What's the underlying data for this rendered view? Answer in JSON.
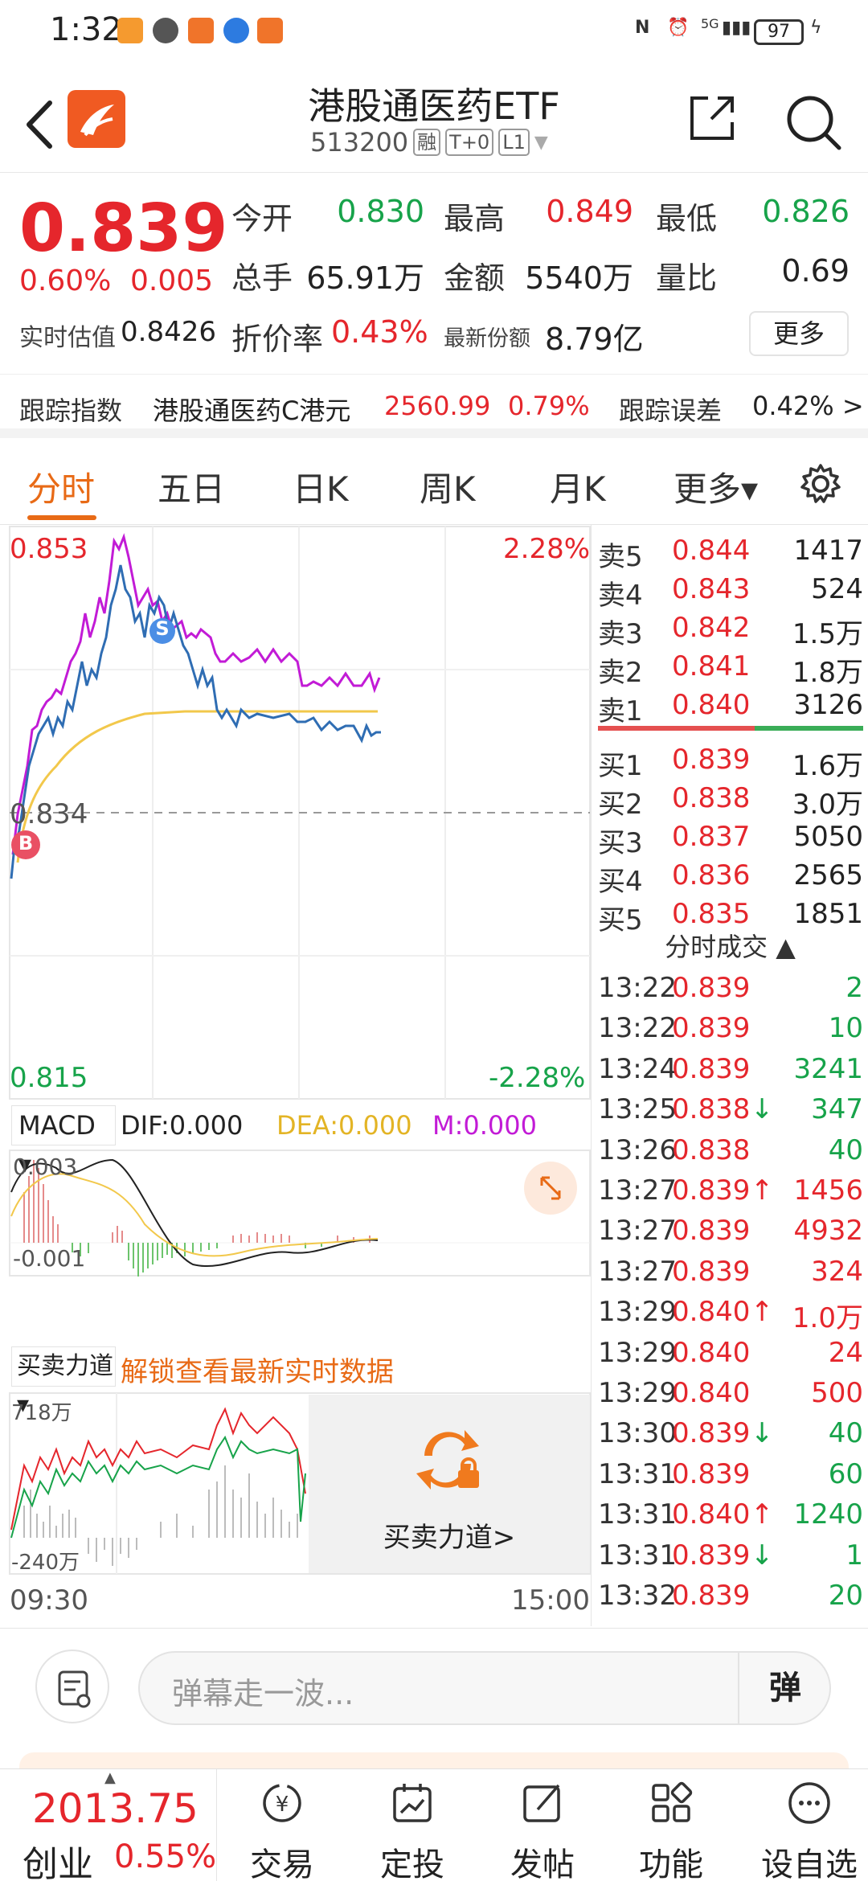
{
  "status_bar": {
    "time": "1:32",
    "signal": "5G",
    "battery": "97"
  },
  "header": {
    "title": "港股通医药ETF",
    "code": "513200",
    "tags": [
      "融",
      "T+0",
      "L1"
    ]
  },
  "quote": {
    "price": "0.839",
    "change_pct": "0.60%",
    "change": "0.005",
    "open_label": "今开",
    "open": "0.830",
    "high_label": "最高",
    "high": "0.849",
    "low_label": "最低",
    "low": "0.826",
    "volume_label": "总手",
    "volume": "65.91万",
    "amount_label": "金额",
    "amount": "5540万",
    "ratio_label": "量比",
    "ratio": "0.69",
    "iopv_label": "实时估值",
    "iopv": "0.8426",
    "premium_label": "折价率",
    "premium": "0.43%",
    "shares_label": "最新份额",
    "shares": "8.79亿",
    "more": "更多"
  },
  "tracking": {
    "label": "跟踪指数",
    "index": "港股通医药C港元",
    "value": "2560.99",
    "pct": "0.79%",
    "error_label": "跟踪误差",
    "error": "0.42% >"
  },
  "tabs": [
    "分时",
    "五日",
    "日K",
    "周K",
    "月K",
    "更多▾"
  ],
  "chart": {
    "y_top": "0.853",
    "y_top_pct": "2.28%",
    "y_mid": "0.834",
    "y_bottom": "0.815",
    "y_bottom_pct": "-2.28%",
    "marker_s": "S",
    "marker_b": "B",
    "macd_selector": "MACD ▾",
    "dif": "DIF:0.000",
    "dea": "DEA:0.000",
    "m": "M:0.000",
    "macd_top": "0.003",
    "macd_bottom": "-0.001",
    "force_selector": "买卖力道 ▾",
    "force_unlock": "解锁查看最新实时数据",
    "force_top": "718万",
    "force_bottom": "-240万",
    "force_overlay_label": "买卖力道>",
    "time_start": "09:30",
    "time_end": "15:00"
  },
  "orderbook": {
    "sell": [
      {
        "label": "卖5",
        "price": "0.844",
        "vol": "1417"
      },
      {
        "label": "卖4",
        "price": "0.843",
        "vol": "524"
      },
      {
        "label": "卖3",
        "price": "0.842",
        "vol": "1.5万"
      },
      {
        "label": "卖2",
        "price": "0.841",
        "vol": "1.8万"
      },
      {
        "label": "卖1",
        "price": "0.840",
        "vol": "3126"
      }
    ],
    "buy": [
      {
        "label": "买1",
        "price": "0.839",
        "vol": "1.6万"
      },
      {
        "label": "买2",
        "price": "0.838",
        "vol": "3.0万"
      },
      {
        "label": "买3",
        "price": "0.837",
        "vol": "5050"
      },
      {
        "label": "买4",
        "price": "0.836",
        "vol": "2565"
      },
      {
        "label": "买5",
        "price": "0.835",
        "vol": "1851"
      }
    ],
    "trades_title": "分时成交 ▲",
    "trades": [
      {
        "time": "13:22",
        "price": "0.839",
        "arrow": "",
        "vol": "2",
        "price_color": "red",
        "vol_color": "green"
      },
      {
        "time": "13:22",
        "price": "0.839",
        "arrow": "",
        "vol": "10",
        "price_color": "red",
        "vol_color": "green"
      },
      {
        "time": "13:24",
        "price": "0.839",
        "arrow": "",
        "vol": "3241",
        "price_color": "red",
        "vol_color": "green"
      },
      {
        "time": "13:25",
        "price": "0.838",
        "arrow": "↓",
        "vol": "347",
        "price_color": "red",
        "vol_color": "green"
      },
      {
        "time": "13:26",
        "price": "0.838",
        "arrow": "",
        "vol": "40",
        "price_color": "red",
        "vol_color": "green"
      },
      {
        "time": "13:27",
        "price": "0.839",
        "arrow": "↑",
        "vol": "1456",
        "price_color": "red",
        "vol_color": "red"
      },
      {
        "time": "13:27",
        "price": "0.839",
        "arrow": "",
        "vol": "4932",
        "price_color": "red",
        "vol_color": "red"
      },
      {
        "time": "13:27",
        "price": "0.839",
        "arrow": "",
        "vol": "324",
        "price_color": "red",
        "vol_color": "red"
      },
      {
        "time": "13:29",
        "price": "0.840",
        "arrow": "↑",
        "vol": "1.0万",
        "price_color": "red",
        "vol_color": "red"
      },
      {
        "time": "13:29",
        "price": "0.840",
        "arrow": "",
        "vol": "24",
        "price_color": "red",
        "vol_color": "red"
      },
      {
        "time": "13:29",
        "price": "0.840",
        "arrow": "",
        "vol": "500",
        "price_color": "red",
        "vol_color": "red"
      },
      {
        "time": "13:30",
        "price": "0.839",
        "arrow": "↓",
        "vol": "40",
        "price_color": "red",
        "vol_color": "green"
      },
      {
        "time": "13:31",
        "price": "0.839",
        "arrow": "",
        "vol": "60",
        "price_color": "red",
        "vol_color": "green"
      },
      {
        "time": "13:31",
        "price": "0.840",
        "arrow": "↑",
        "vol": "1240",
        "price_color": "red",
        "vol_color": "green"
      },
      {
        "time": "13:31",
        "price": "0.839",
        "arrow": "↓",
        "vol": "1",
        "price_color": "red",
        "vol_color": "green"
      },
      {
        "time": "13:32",
        "price": "0.839",
        "arrow": "",
        "vol": "20",
        "price_color": "red",
        "vol_color": "green"
      }
    ]
  },
  "comment": {
    "placeholder": "弹幕走一波...",
    "button": "弹"
  },
  "tabbar": {
    "index_value": "2013.75",
    "index_name": "创业",
    "index_pct": "0.55%",
    "items": [
      "交易",
      "定投",
      "发帖",
      "功能",
      "设自选"
    ]
  },
  "colors": {
    "up": "#e5262c",
    "down": "#17a34a",
    "accent": "#e86a16",
    "avg": "#f2c84b",
    "line": "#2f6db3",
    "purple": "#c21bd6"
  }
}
